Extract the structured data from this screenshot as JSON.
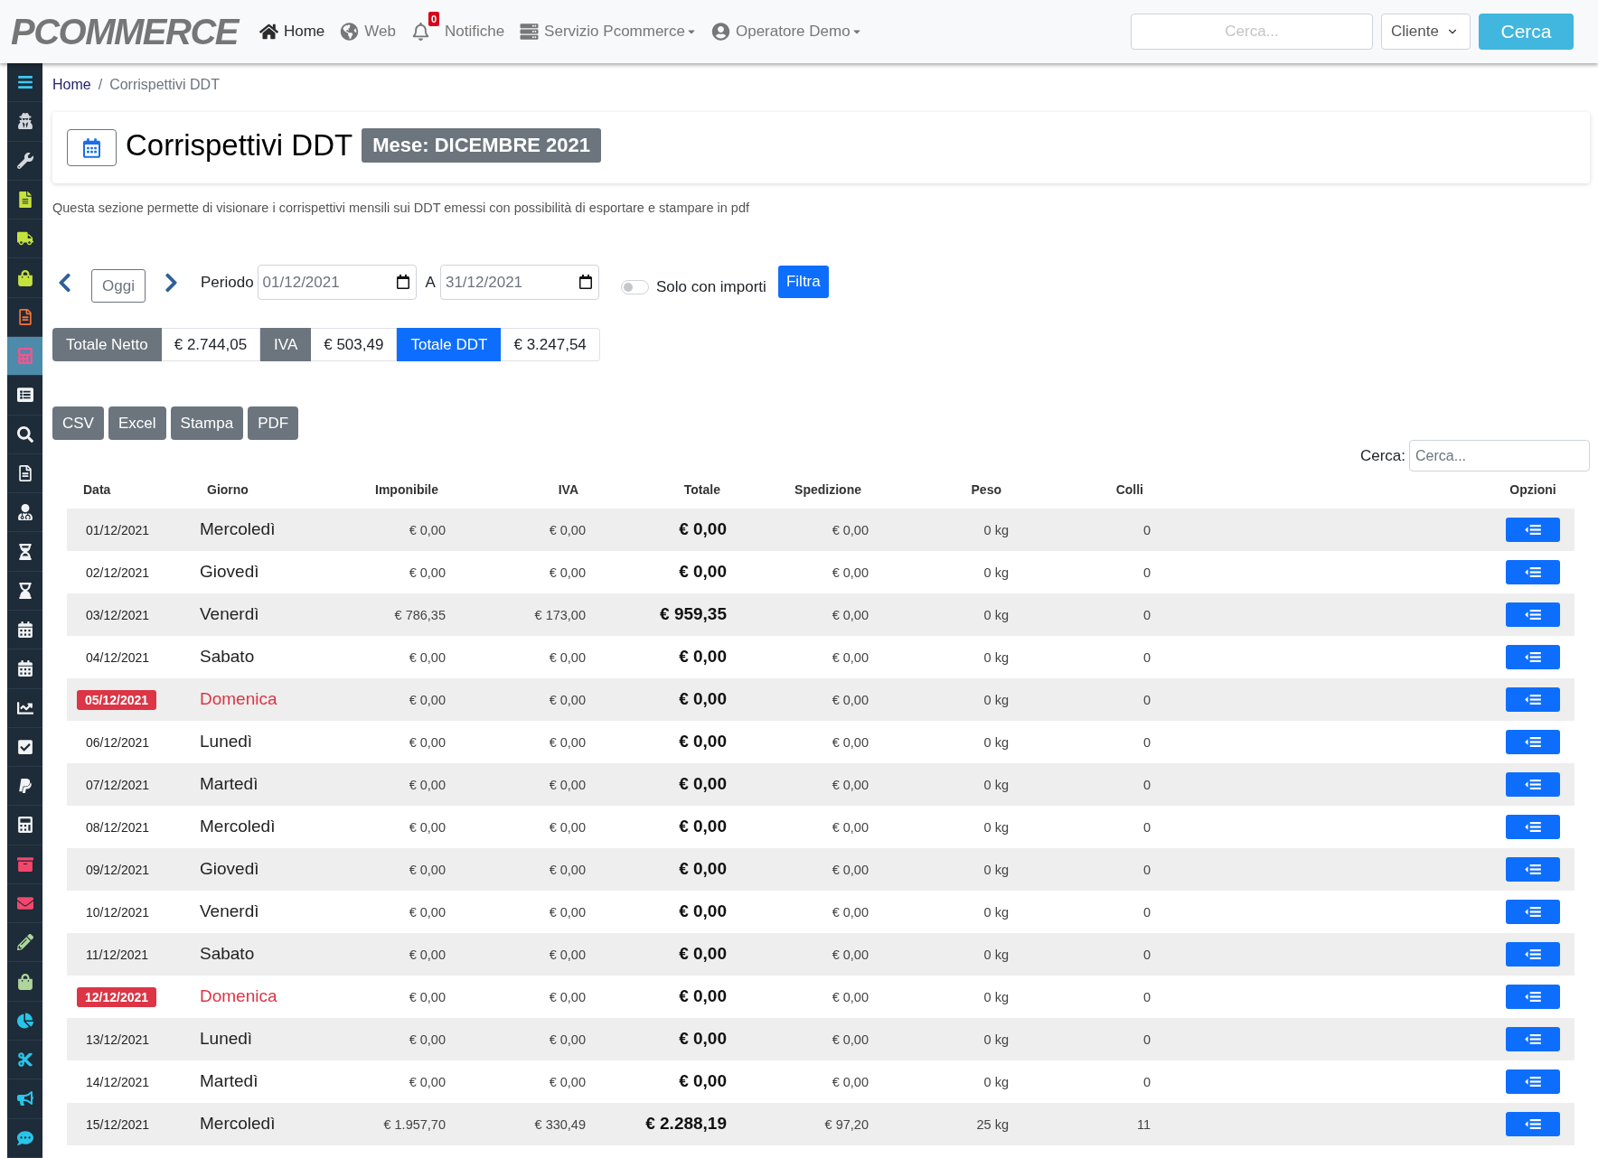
{
  "navbar": {
    "logo": "PCOMMERCE",
    "items": [
      {
        "label": "Home",
        "selected": true,
        "dropdown": false
      },
      {
        "label": "Web",
        "selected": false,
        "dropdown": false
      },
      {
        "label": "Notifiche",
        "selected": false,
        "dropdown": false,
        "badge": "0"
      },
      {
        "label": "Servizio Pcommerce",
        "selected": false,
        "dropdown": true
      },
      {
        "label": "Operatore Demo",
        "selected": false,
        "dropdown": true
      }
    ],
    "search": {
      "placeholder": "Cerca..."
    },
    "search_scope": {
      "value": "Cliente"
    },
    "search_button": "Cerca"
  },
  "sidebar": {
    "items": [
      {
        "selected": false,
        "color": "#3ccbf4"
      },
      {
        "selected": false,
        "color": "#d4d8dd"
      },
      {
        "selected": false,
        "color": "#d4d8dd"
      },
      {
        "selected": false,
        "color": "#c5e33d"
      },
      {
        "selected": false,
        "color": "#c5e33d"
      },
      {
        "selected": false,
        "color": "#c5e33d"
      },
      {
        "selected": false,
        "color": "#f4733a"
      },
      {
        "selected": true,
        "color": "#f25590"
      },
      {
        "selected": false,
        "color": "#f1f3f5"
      },
      {
        "selected": false,
        "color": "#f1f3f5"
      },
      {
        "selected": false,
        "color": "#f1f3f5"
      },
      {
        "selected": false,
        "color": "#f1f3f5"
      },
      {
        "selected": false,
        "color": "#f1f3f5"
      },
      {
        "selected": false,
        "color": "#f1f3f5"
      },
      {
        "selected": false,
        "color": "#f1f3f5"
      },
      {
        "selected": false,
        "color": "#f1f3f5"
      },
      {
        "selected": false,
        "color": "#f1f3f5"
      },
      {
        "selected": false,
        "color": "#f1f3f5"
      },
      {
        "selected": false,
        "color": "#f1f3f5"
      },
      {
        "selected": false,
        "color": "#f1f3f5"
      },
      {
        "selected": false,
        "color": "#f4476b"
      },
      {
        "selected": false,
        "color": "#f4476b"
      },
      {
        "selected": false,
        "color": "#aed69a"
      },
      {
        "selected": false,
        "color": "#aed69a"
      },
      {
        "selected": false,
        "color": "#29c4e8"
      },
      {
        "selected": false,
        "color": "#29c4e8"
      },
      {
        "selected": false,
        "color": "#29c4e8"
      },
      {
        "selected": false,
        "color": "#29c4e8"
      }
    ]
  },
  "breadcrumb": {
    "separator": "/",
    "items": [
      {
        "label": "Home",
        "kind": "link"
      },
      {
        "label": "Corrispettivi DDT",
        "kind": "current"
      }
    ]
  },
  "page_header": {
    "title": "Corrispettivi DDT",
    "badge": "Mese: DICEMBRE 2021"
  },
  "description": "Questa sezione permette di visionare i corrispettivi mensili sui DDT emessi con possibilità di esportare e stampare in pdf",
  "filter": {
    "today_button": "Oggi",
    "period_label": "Periodo",
    "date_from": "01/12/2021",
    "to_label": "A",
    "date_to": "31/12/2021",
    "amounts_only": {
      "label": "Solo con importi",
      "on": false
    },
    "filter_button": "Filtra"
  },
  "totals": [
    {
      "label": "Totale Netto",
      "value": "€ 2.744,05",
      "color": "#6c757d"
    },
    {
      "label": "IVA",
      "value": "€ 503,49",
      "color": "#6c757d"
    },
    {
      "label": "Totale DDT",
      "value": "€ 3.247,54",
      "color": "#0d6efd"
    }
  ],
  "export_buttons": [
    "CSV",
    "Excel",
    "Stampa",
    "PDF"
  ],
  "table": {
    "search": {
      "label": "Cerca:",
      "placeholder": "Cerca..."
    },
    "columns": [
      "Data",
      "Giorno",
      "Imponibile",
      "IVA",
      "Totale",
      "Spedizione",
      "Peso",
      "Colli",
      "Opzioni"
    ],
    "rows": [
      {
        "data": "01/12/2021",
        "giorno": "Mercoledì",
        "imponibile": "€ 0,00",
        "iva": "€ 0,00",
        "totale": "€ 0,00",
        "spedizione": "€ 0,00",
        "peso": "0 kg",
        "colli": "0",
        "holiday": false
      },
      {
        "data": "02/12/2021",
        "giorno": "Giovedì",
        "imponibile": "€ 0,00",
        "iva": "€ 0,00",
        "totale": "€ 0,00",
        "spedizione": "€ 0,00",
        "peso": "0 kg",
        "colli": "0",
        "holiday": false
      },
      {
        "data": "03/12/2021",
        "giorno": "Venerdì",
        "imponibile": "€ 786,35",
        "iva": "€ 173,00",
        "totale": "€ 959,35",
        "spedizione": "€ 0,00",
        "peso": "0 kg",
        "colli": "0",
        "holiday": false
      },
      {
        "data": "04/12/2021",
        "giorno": "Sabato",
        "imponibile": "€ 0,00",
        "iva": "€ 0,00",
        "totale": "€ 0,00",
        "spedizione": "€ 0,00",
        "peso": "0 kg",
        "colli": "0",
        "holiday": false
      },
      {
        "data": "05/12/2021",
        "giorno": "Domenica",
        "imponibile": "€ 0,00",
        "iva": "€ 0,00",
        "totale": "€ 0,00",
        "spedizione": "€ 0,00",
        "peso": "0 kg",
        "colli": "0",
        "holiday": true
      },
      {
        "data": "06/12/2021",
        "giorno": "Lunedì",
        "imponibile": "€ 0,00",
        "iva": "€ 0,00",
        "totale": "€ 0,00",
        "spedizione": "€ 0,00",
        "peso": "0 kg",
        "colli": "0",
        "holiday": false
      },
      {
        "data": "07/12/2021",
        "giorno": "Martedì",
        "imponibile": "€ 0,00",
        "iva": "€ 0,00",
        "totale": "€ 0,00",
        "spedizione": "€ 0,00",
        "peso": "0 kg",
        "colli": "0",
        "holiday": false
      },
      {
        "data": "08/12/2021",
        "giorno": "Mercoledì",
        "imponibile": "€ 0,00",
        "iva": "€ 0,00",
        "totale": "€ 0,00",
        "spedizione": "€ 0,00",
        "peso": "0 kg",
        "colli": "0",
        "holiday": false
      },
      {
        "data": "09/12/2021",
        "giorno": "Giovedì",
        "imponibile": "€ 0,00",
        "iva": "€ 0,00",
        "totale": "€ 0,00",
        "spedizione": "€ 0,00",
        "peso": "0 kg",
        "colli": "0",
        "holiday": false
      },
      {
        "data": "10/12/2021",
        "giorno": "Venerdì",
        "imponibile": "€ 0,00",
        "iva": "€ 0,00",
        "totale": "€ 0,00",
        "spedizione": "€ 0,00",
        "peso": "0 kg",
        "colli": "0",
        "holiday": false
      },
      {
        "data": "11/12/2021",
        "giorno": "Sabato",
        "imponibile": "€ 0,00",
        "iva": "€ 0,00",
        "totale": "€ 0,00",
        "spedizione": "€ 0,00",
        "peso": "0 kg",
        "colli": "0",
        "holiday": false
      },
      {
        "data": "12/12/2021",
        "giorno": "Domenica",
        "imponibile": "€ 0,00",
        "iva": "€ 0,00",
        "totale": "€ 0,00",
        "spedizione": "€ 0,00",
        "peso": "0 kg",
        "colli": "0",
        "holiday": true
      },
      {
        "data": "13/12/2021",
        "giorno": "Lunedì",
        "imponibile": "€ 0,00",
        "iva": "€ 0,00",
        "totale": "€ 0,00",
        "spedizione": "€ 0,00",
        "peso": "0 kg",
        "colli": "0",
        "holiday": false
      },
      {
        "data": "14/12/2021",
        "giorno": "Martedì",
        "imponibile": "€ 0,00",
        "iva": "€ 0,00",
        "totale": "€ 0,00",
        "spedizione": "€ 0,00",
        "peso": "0 kg",
        "colli": "0",
        "holiday": false
      },
      {
        "data": "15/12/2021",
        "giorno": "Mercoledì",
        "imponibile": "€ 1.957,70",
        "iva": "€ 330,49",
        "totale": "€ 2.288,19",
        "spedizione": "€ 97,20",
        "peso": "25 kg",
        "colli": "11",
        "holiday": false
      }
    ]
  }
}
